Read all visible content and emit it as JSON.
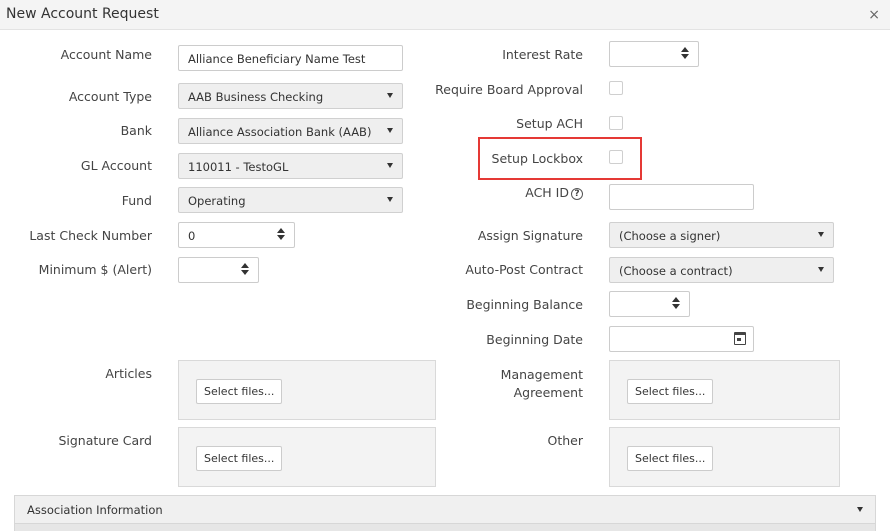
{
  "window": {
    "title": "New Account Request",
    "close_symbol": "×"
  },
  "left_fields": {
    "account_name": {
      "label": "Account Name",
      "value": "Alliance Beneficiary Name Test"
    },
    "account_type": {
      "label": "Account Type",
      "value": "AAB Business Checking"
    },
    "bank": {
      "label": "Bank",
      "value": "Alliance Association Bank (AAB)"
    },
    "gl_account": {
      "label": "GL Account",
      "value": "110011 - TestoGL"
    },
    "fund": {
      "label": "Fund",
      "value": "Operating"
    },
    "last_check_number": {
      "label": "Last Check Number",
      "value": "0"
    },
    "minimum_alert": {
      "label": "Minimum $ (Alert)",
      "value": ""
    }
  },
  "right_fields": {
    "interest_rate": {
      "label": "Interest Rate",
      "value": ""
    },
    "require_board_approval": {
      "label": "Require Board Approval",
      "checked": false
    },
    "setup_ach": {
      "label": "Setup ACH",
      "checked": false
    },
    "setup_lockbox": {
      "label": "Setup Lockbox",
      "checked": false
    },
    "ach_id": {
      "label": "ACH ID",
      "help_symbol": "?",
      "value": ""
    },
    "assign_signature": {
      "label": "Assign Signature",
      "value": "(Choose a signer)"
    },
    "auto_post_contract": {
      "label": "Auto-Post Contract",
      "value": "(Choose a contract)"
    },
    "beginning_balance": {
      "label": "Beginning Balance",
      "value": ""
    },
    "beginning_date": {
      "label": "Beginning Date",
      "value": ""
    }
  },
  "uploads": {
    "articles": {
      "label": "Articles",
      "button": "Select files..."
    },
    "management_agreement": {
      "label_line1": "Management",
      "label_line2": "Agreement",
      "button": "Select files..."
    },
    "signature_card": {
      "label": "Signature Card",
      "button": "Select files..."
    },
    "other": {
      "label": "Other",
      "button": "Select files..."
    }
  },
  "sections": {
    "association_information": "Association Information"
  },
  "icons": {
    "close": "close-icon",
    "select_caret": "chevron-down-icon",
    "spinner": "spinner-arrows-icon",
    "help": "help-circle-icon",
    "calendar": "calendar-icon"
  },
  "colors": {
    "highlight_border": "#e53935",
    "dropzone_bg": "#f3f3f3",
    "select_bg": "#efefef"
  }
}
